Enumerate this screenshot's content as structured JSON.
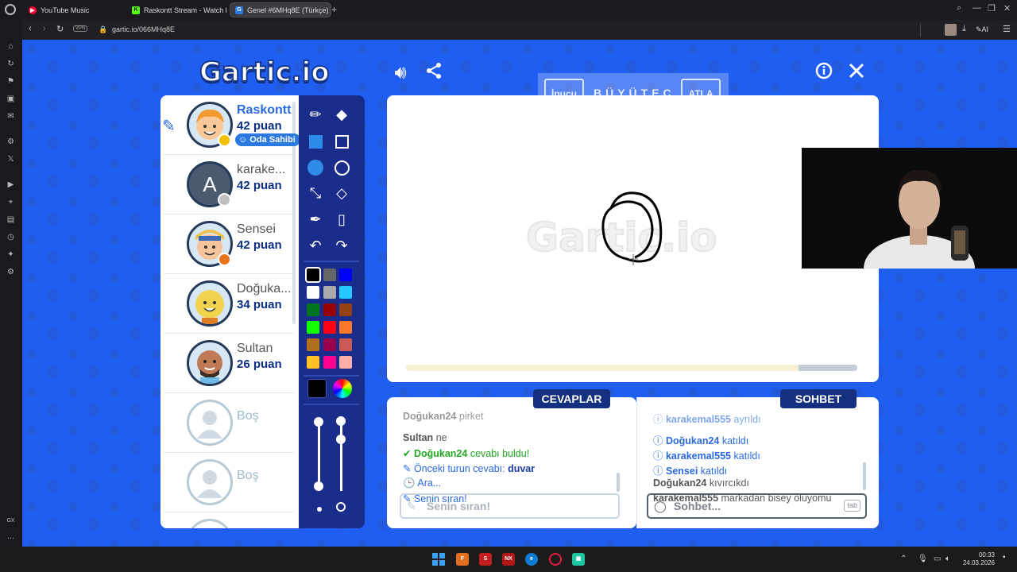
{
  "browser": {
    "tabs": [
      {
        "label": "YouTube Music",
        "favicon_color": "#ff0033"
      },
      {
        "label": "Raskontt Stream - Watch l",
        "favicon_color": "#53fc18"
      },
      {
        "label": "Genel #6MHq8E (Türkçe)",
        "favicon_color": "#2a7ae2"
      }
    ],
    "address": "gartic.io/066MHq8E",
    "vpn_label": "VPN",
    "ai_label": "AI"
  },
  "sidebar": {
    "bottom_label": "GX"
  },
  "game": {
    "logo": "Gartic.io",
    "hint": {
      "hint_button": "İpucu",
      "word": "BÜYÜTEÇ",
      "skip_button": "ATLA"
    },
    "players": [
      {
        "name": "Raskontt",
        "points": "42 puan",
        "badge": "Oda Sahibi",
        "dot_color": "#f5c000",
        "drawing": true,
        "name_color": "#2a6ae0",
        "avatar_color": "#f6a235"
      },
      {
        "name": "karake...",
        "points": "42 puan",
        "initial": "A",
        "dot_color": "#bfbfbf",
        "name_color": "#555555",
        "avatar_color": "#48566a"
      },
      {
        "name": "Sensei",
        "points": "42 puan",
        "dot_color": "#e8731a",
        "name_color": "#555555",
        "avatar_color": "#f1c152"
      },
      {
        "name": "Doğuka...",
        "points": "34 puan",
        "name_color": "#555555",
        "avatar_color": "#f3d24d"
      },
      {
        "name": "Sultan",
        "points": "26 puan",
        "name_color": "#555555",
        "avatar_color": "#c17a56"
      },
      {
        "name": "Boş",
        "points": "",
        "name_color": "#9fb9cc",
        "avatar_color": "#cfdae3"
      },
      {
        "name": "Boş",
        "points": "",
        "name_color": "#9fb9cc",
        "avatar_color": "#cfdae3"
      }
    ],
    "palette": [
      "#000000",
      "#676767",
      "#0000ff",
      "#ffffff",
      "#aaaaaa",
      "#26c9ff",
      "#017420",
      "#990000",
      "#964112",
      "#11ff00",
      "#ff0013",
      "#ff7829",
      "#b0701c",
      "#99004e",
      "#cb5a57",
      "#ffc126",
      "#ff008f",
      "#feafa8"
    ],
    "current_color": "#000000",
    "canvas_watermark": "Gartic.io",
    "progress": 0.87,
    "answers": {
      "title": "CEVAPLAR",
      "messages": [
        {
          "user": "Doğukan24",
          "text": "pirket",
          "color": "#5a5a5a",
          "icon": ""
        },
        {
          "user": "Sultan",
          "text": "ne",
          "color": "#5a5a5a",
          "icon": ""
        },
        {
          "user": "Doğukan24",
          "text": "cevabı buldu!",
          "color": "#22a822",
          "icon": "✔"
        },
        {
          "user": "",
          "text": "Önceki turun cevabı: ",
          "extra": "duvar",
          "color": "#2a6ae0",
          "icon": "✎"
        },
        {
          "user": "",
          "text": "Ara...",
          "color": "#2a6ae0",
          "icon": "🕒"
        },
        {
          "user": "",
          "text": "Senin sıran!",
          "color": "#2a6ae0",
          "icon": "✎"
        }
      ],
      "input_placeholder": "Senin sıran!"
    },
    "chat": {
      "title": "SOHBET",
      "messages": [
        {
          "user": "karakemal555",
          "text": "ayrıldı",
          "color": "#2a6ae0",
          "icon": "ⓘ"
        },
        {
          "user": "Doğukan24",
          "text": "katıldı",
          "color": "#2a6ae0",
          "icon": "ⓘ"
        },
        {
          "user": "karakemal555",
          "text": "katıldı",
          "color": "#2a6ae0",
          "icon": "ⓘ"
        },
        {
          "user": "Sensei",
          "text": "katıldı",
          "color": "#2a6ae0",
          "icon": "ⓘ"
        },
        {
          "user": "Doğukan24",
          "text": "kıvırcıkdı",
          "color": "#5a5a5a",
          "icon": ""
        },
        {
          "user": "karakemal555",
          "text": "markadan bisey oluyomu",
          "color": "#5a5a5a",
          "icon": ""
        }
      ],
      "input_placeholder": "Sohbet...",
      "tab_hint": "tab"
    }
  },
  "taskbar": {
    "time": "00:33",
    "date": "24.03.2026"
  }
}
